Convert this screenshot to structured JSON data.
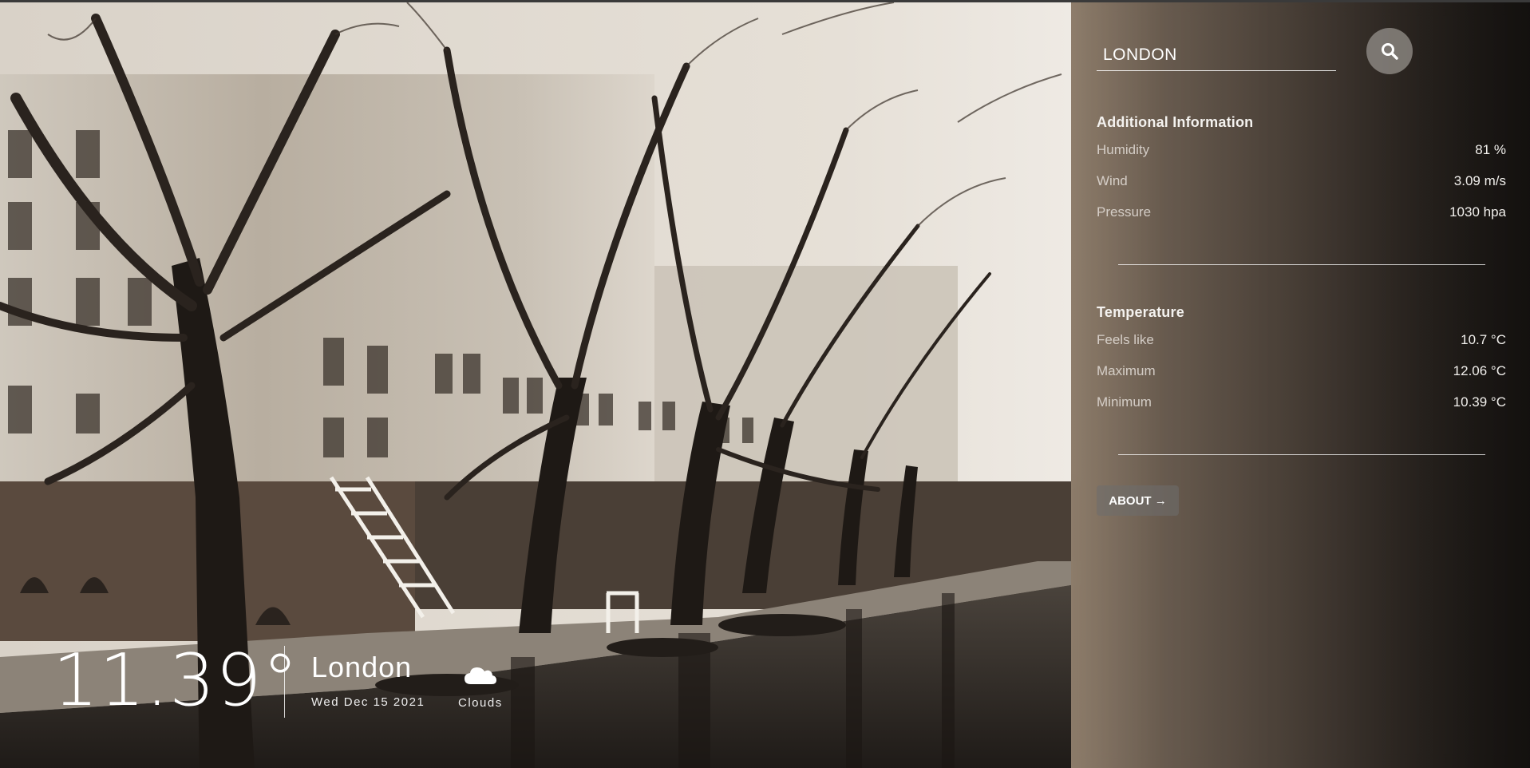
{
  "search": {
    "value": "LONDON",
    "icon": "search-icon"
  },
  "additional": {
    "title": "Additional Information",
    "rows": [
      {
        "label": "Humidity",
        "value": "81 %"
      },
      {
        "label": "Wind",
        "value": "3.09 m/s"
      },
      {
        "label": "Pressure",
        "value": "1030 hpa"
      }
    ]
  },
  "temperature": {
    "title": "Temperature",
    "rows": [
      {
        "label": "Feels like",
        "value": "10.7 °C"
      },
      {
        "label": "Maximum",
        "value": "12.06 °C"
      },
      {
        "label": "Minimum",
        "value": "10.39 °C"
      }
    ]
  },
  "about_label": "ABOUT →",
  "current": {
    "temp": "11.39°",
    "city": "London",
    "date": "Wed Dec 15 2021",
    "condition": "Clouds",
    "condition_icon": "cloud-icon"
  },
  "colors": {
    "panel": "#3a322b",
    "text": "#ffffff",
    "button": "#8a8784"
  }
}
